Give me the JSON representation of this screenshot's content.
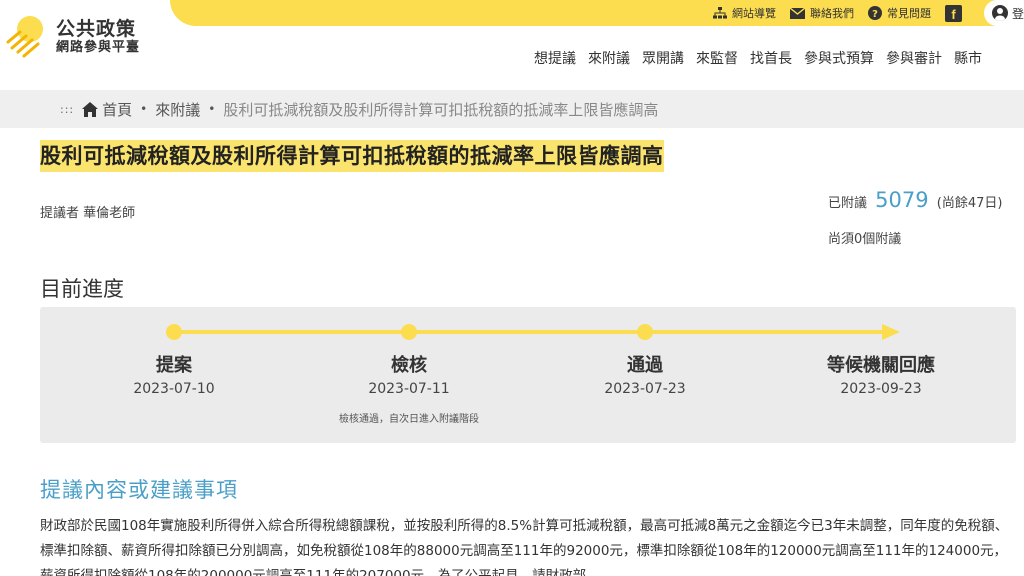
{
  "top_links": [
    {
      "icon": "sitemap-icon",
      "label": "網站導覽"
    },
    {
      "icon": "mail-icon",
      "label": "聯絡我們"
    },
    {
      "icon": "question-icon",
      "label": "常見問題"
    }
  ],
  "facebook_label": "f",
  "login_label": "登",
  "logo": {
    "line1": "公共政策",
    "line2": "網路參與平臺"
  },
  "nav": [
    "想提議",
    "來附議",
    "眾開講",
    "來監督",
    "找首長",
    "參與式預算",
    "參與審計",
    "縣市"
  ],
  "breadcrumb": {
    "dots": ":::",
    "home": "首頁",
    "sep": "•",
    "section": "來附議",
    "current": "股利可抵減稅額及股利所得計算可扣抵稅額的抵減率上限皆應調高"
  },
  "proposal": {
    "title": "股利可抵減稅額及股利所得計算可扣抵稅額的抵減率上限皆應調高",
    "proposer": "提議者 華倫老師",
    "signed_label": "已附議",
    "signed_count": "5079",
    "remaining": "(尚餘47日)",
    "needed": "尚須0個附議"
  },
  "progress": {
    "title": "目前進度",
    "steps": [
      {
        "name": "提案",
        "date": "2023-07-10",
        "note": ""
      },
      {
        "name": "檢核",
        "date": "2023-07-11",
        "note": "檢核通過，自次日進入附議階段"
      },
      {
        "name": "通過",
        "date": "2023-07-23",
        "note": ""
      },
      {
        "name": "等候機關回應",
        "date": "2023-09-23",
        "note": ""
      }
    ]
  },
  "content": {
    "title": "提議內容或建議事項",
    "body": "財政部於民國108年實施股利所得併入綜合所得稅總額課稅，並按股利所得的8.5%計算可抵減稅額，最高可抵減8萬元之金額迄今已3年未調整，同年度的免稅額、標準扣除額、薪資所得扣除額已分別調高，如免稅額從108年的88000元調高至111年的92000元，標準扣除額從108年的120000元調高至111年的124000元，薪資所得扣除額從108年的200000元調高至111年的207000元，為了公平起見，請財政部"
  },
  "colors": {
    "accent_yellow": "#fbdd4f",
    "highlight": "#fbe46e",
    "link_blue": "#4a9fc9",
    "panel_gray": "#ebebeb"
  }
}
